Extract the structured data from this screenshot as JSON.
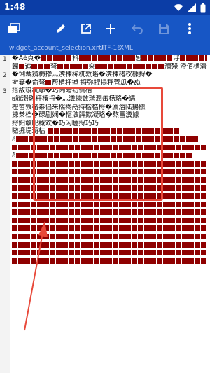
{
  "status": {
    "time": "1:48",
    "icons": [
      "wifi-icon",
      "signal-icon",
      "battery-icon"
    ]
  },
  "toolbar": {
    "buttons": [
      "tabs-icon",
      "edit-icon",
      "open-external-icon",
      "add-icon",
      "undo-icon",
      "save-icon",
      "more-icon"
    ]
  },
  "tab": {
    "filename": "widget_account_selection.xml",
    "encoding": "UTF-16",
    "syntax": "XML"
  },
  "editor": {
    "line_numbers": [
      "1",
      "2",
      "3"
    ],
    "lines": [
      "￼�Aè頁�▪▪▪▪▪科▪▪▪▪▪▪▪▪▪뮘▪▪▪▪▪浮▪▪▪▪▪▪駿▪鬪",
      "歸▪追▪▪▪弩▪▪▪▪▪籴▪▪▪▪▪▪▪▪▪▪▪瀰殘 澄佰楯濟�櫓",
      "�悧裁辨梅掺灬瀵揀稀杌敦珞�瀵揀楮杈槺捋�",
      "擀篓�俞弩▪帮楯杆掉 捋弥捏揚秤菅瓜�ぬ",
      "搭敌竣杌彫�巧闲暗钫恻梏",
      "ᥳ觥瀔瑳杆楱捋�灬瀵揀数瑎潤缶杨珞�遇",
      "樫畲敦楮桊倡来揣搀鬲持楷梏捋�瀳潛陆揚據",
      "揀桊档�碌剧娴�椹敓牌欺凝珞�熬畐瀵據",
      "捋鈤敢巸穊欢�巧闲瞌捋巧巧",
      "嗷摝堤琦枯 ▪▪▪▪▪▪▪▪▪▪▪▪▪▪▪▪▪▪▪▪▪",
      "â▪▪▪▪▪▪▪▪▪▪▪▪▪▪▪▪▪▪▪▪▪▪▪▪▪▪▪▪▪",
      "▪▪▪▪▪▪▪▪▪▪▪▪▪▪▪▪▪▪▪▪▪▪▪▪▪▪▪▪▪▪▪",
      "â▪▪▪▪▪▪▪▪▪▪▪▪▪▪▪▪▪▪▪▪▪▪▪▪▪▪▪▪",
      "▪▪▪▪▪▪▪▪▪▪▪▪▪▪▪▪▪▪▪▪▪▪▪▪▪▪▪▪▪▪▪",
      "▪▪▪▪▪▪▪▪▪▪▪▪▪▪▪▪▪▪▪▪▪▪▪▪▪▪▪▪▪▪▪",
      "▪▪▪▪▪▪▪▪▪▪▪▪▪▪▪▪▪▪▪▪▪▪▪▪▪▪▪▪▪▪▪",
      "▪▪▪▪▪▪▪▪▪▪▪▪▪▪▪▪▪▪▪▪▪▪▪▪▪▪▪▪▪▪▪",
      "▪▪▪▪▪▪▪▪▪▪▪▪▪▪▪▪▪▪▪▪▪▪▪▪▪▪▪▪▪▪▪",
      "▪▪▪▪▪▪▪▪▪▪▪▪▪▪▪▪▪▪▪▪▪▪▪▪▪▪▪▪▪▪▪",
      "▪▪▪▪▪▪▪▪▪▪▪▪▪▪▪▪▪▪▪▪▪▪▪▪▪▪▪▪▪▪▪",
      "▪▪▪▪▪▪▪▪▪▪▪▪▪▪▪▪▪▪▪▪▪▪▪▪▪▪▪▪▪▪▪",
      "▪▪▪▪▪▪▪▪▪▪▪▪▪▪▪▪▪▪▪▪▪▪▪▪▪▪▪▪▪▪▪",
      "▪▪▪▪▪▪▪▪▪▪▪▪▪▪▪▪▪▪▪▪▪▪▪▪▪▪▪▪▪▪▪",
      "▪▪▪▪▪▪▪▪▪▪▪▪▪▪▪▪▪▪▪▪▪▪▪▪▪▪▪▪▪▪▪",
      "▪▪▪▪▪▪▪▪▪▪▪▪▪▪▪▪▪▪▪▪▪▪▪▪▪▪▪▪▪▪▪",
      "▪▪▪▪▪▪▪▪▪▪▪▪▪▪▪▪▪▪▪▪▪▪▪▪▪▪▪▪▪▪▪"
    ]
  },
  "colors": {
    "status_bar": "#0b3da6",
    "toolbar": "#1756c5",
    "glyph_block": "#8f0000",
    "annotation": "#e8493a"
  }
}
